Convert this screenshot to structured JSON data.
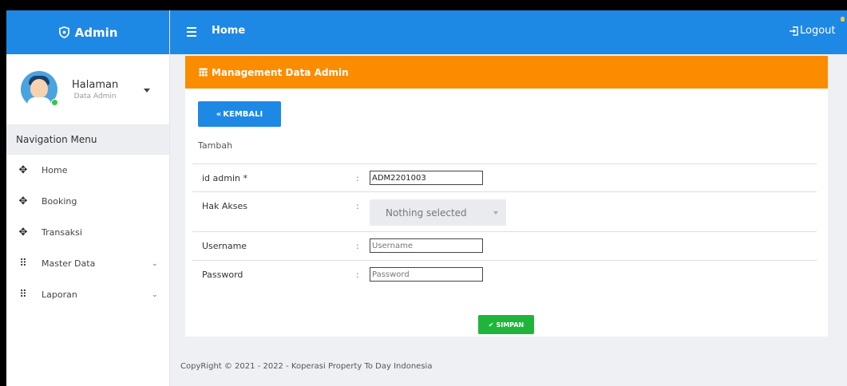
{
  "brand": {
    "title": "Admin",
    "icon": "shield-icon"
  },
  "user": {
    "name": "Halaman",
    "role": "Data Admin",
    "status_color": "#2ecc40"
  },
  "sidebar": {
    "nav_header": "Navigation Menu",
    "items": [
      {
        "label": "Home",
        "icon": "move-icon",
        "has_children": false
      },
      {
        "label": "Booking",
        "icon": "move-icon",
        "has_children": false
      },
      {
        "label": "Transaksi",
        "icon": "move-icon",
        "has_children": false
      },
      {
        "label": "Master Data",
        "icon": "grid-icon",
        "has_children": true
      },
      {
        "label": "Laporan",
        "icon": "grid-icon",
        "has_children": true
      }
    ]
  },
  "topbar": {
    "title": "Home",
    "logout_label": "Logout"
  },
  "card": {
    "header": "Management Data Admin",
    "back_label": "KEMBALI",
    "subtitle": "Tambah",
    "fields": {
      "id_admin": {
        "label": "id admin *",
        "value": "ADM2201003"
      },
      "hak_akses": {
        "label": "Hak Akses",
        "selected": "Nothing selected"
      },
      "username": {
        "label": "Username",
        "placeholder": "Username",
        "value": ""
      },
      "password": {
        "label": "Password",
        "placeholder": "Password",
        "value": ""
      }
    },
    "colon": ":",
    "save_label": "SIMPAN"
  },
  "footer": {
    "text": "CopyRight © 2021 - 2022 - Koperasi Property To Day Indonesia"
  },
  "colors": {
    "primary": "#1e88e5",
    "warning": "#fb8c00",
    "success": "#1fb53a"
  }
}
